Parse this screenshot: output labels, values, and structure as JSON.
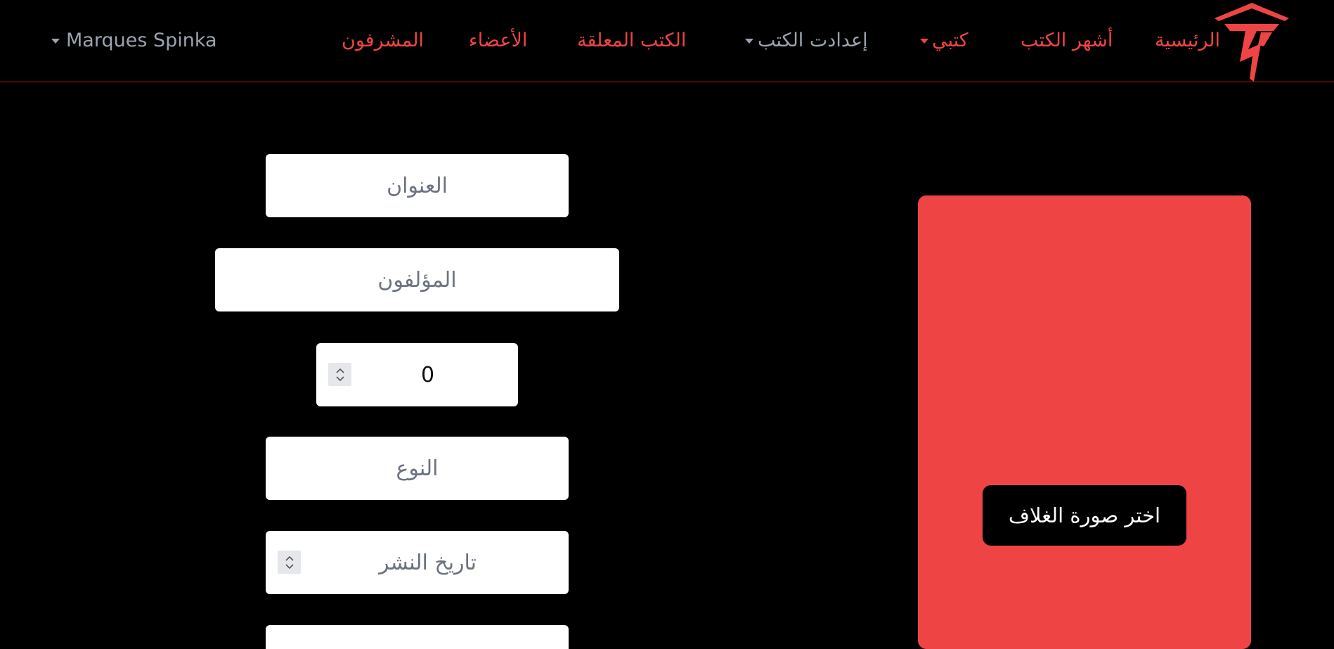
{
  "navbar": {
    "links": {
      "home": "الرئيسية",
      "popular": "أشهر الكتب",
      "my_books": "كتبي",
      "book_settings": "إعدادت الكتب",
      "pending": "الكتب المعلقة",
      "members": "الأعضاء",
      "moderators": "المشرفون"
    },
    "user_name": "Marques Spinka"
  },
  "form": {
    "title_placeholder": "العنوان",
    "authors_placeholder": "المؤلفون",
    "number_value": "0",
    "genre_placeholder": "النوع",
    "publish_date_placeholder": "تاريخ النشر"
  },
  "cover": {
    "button_label": "اختر صورة الغلاف"
  },
  "colors": {
    "accent": "#ef4444",
    "muted": "#9ca3af",
    "background": "#000000"
  }
}
